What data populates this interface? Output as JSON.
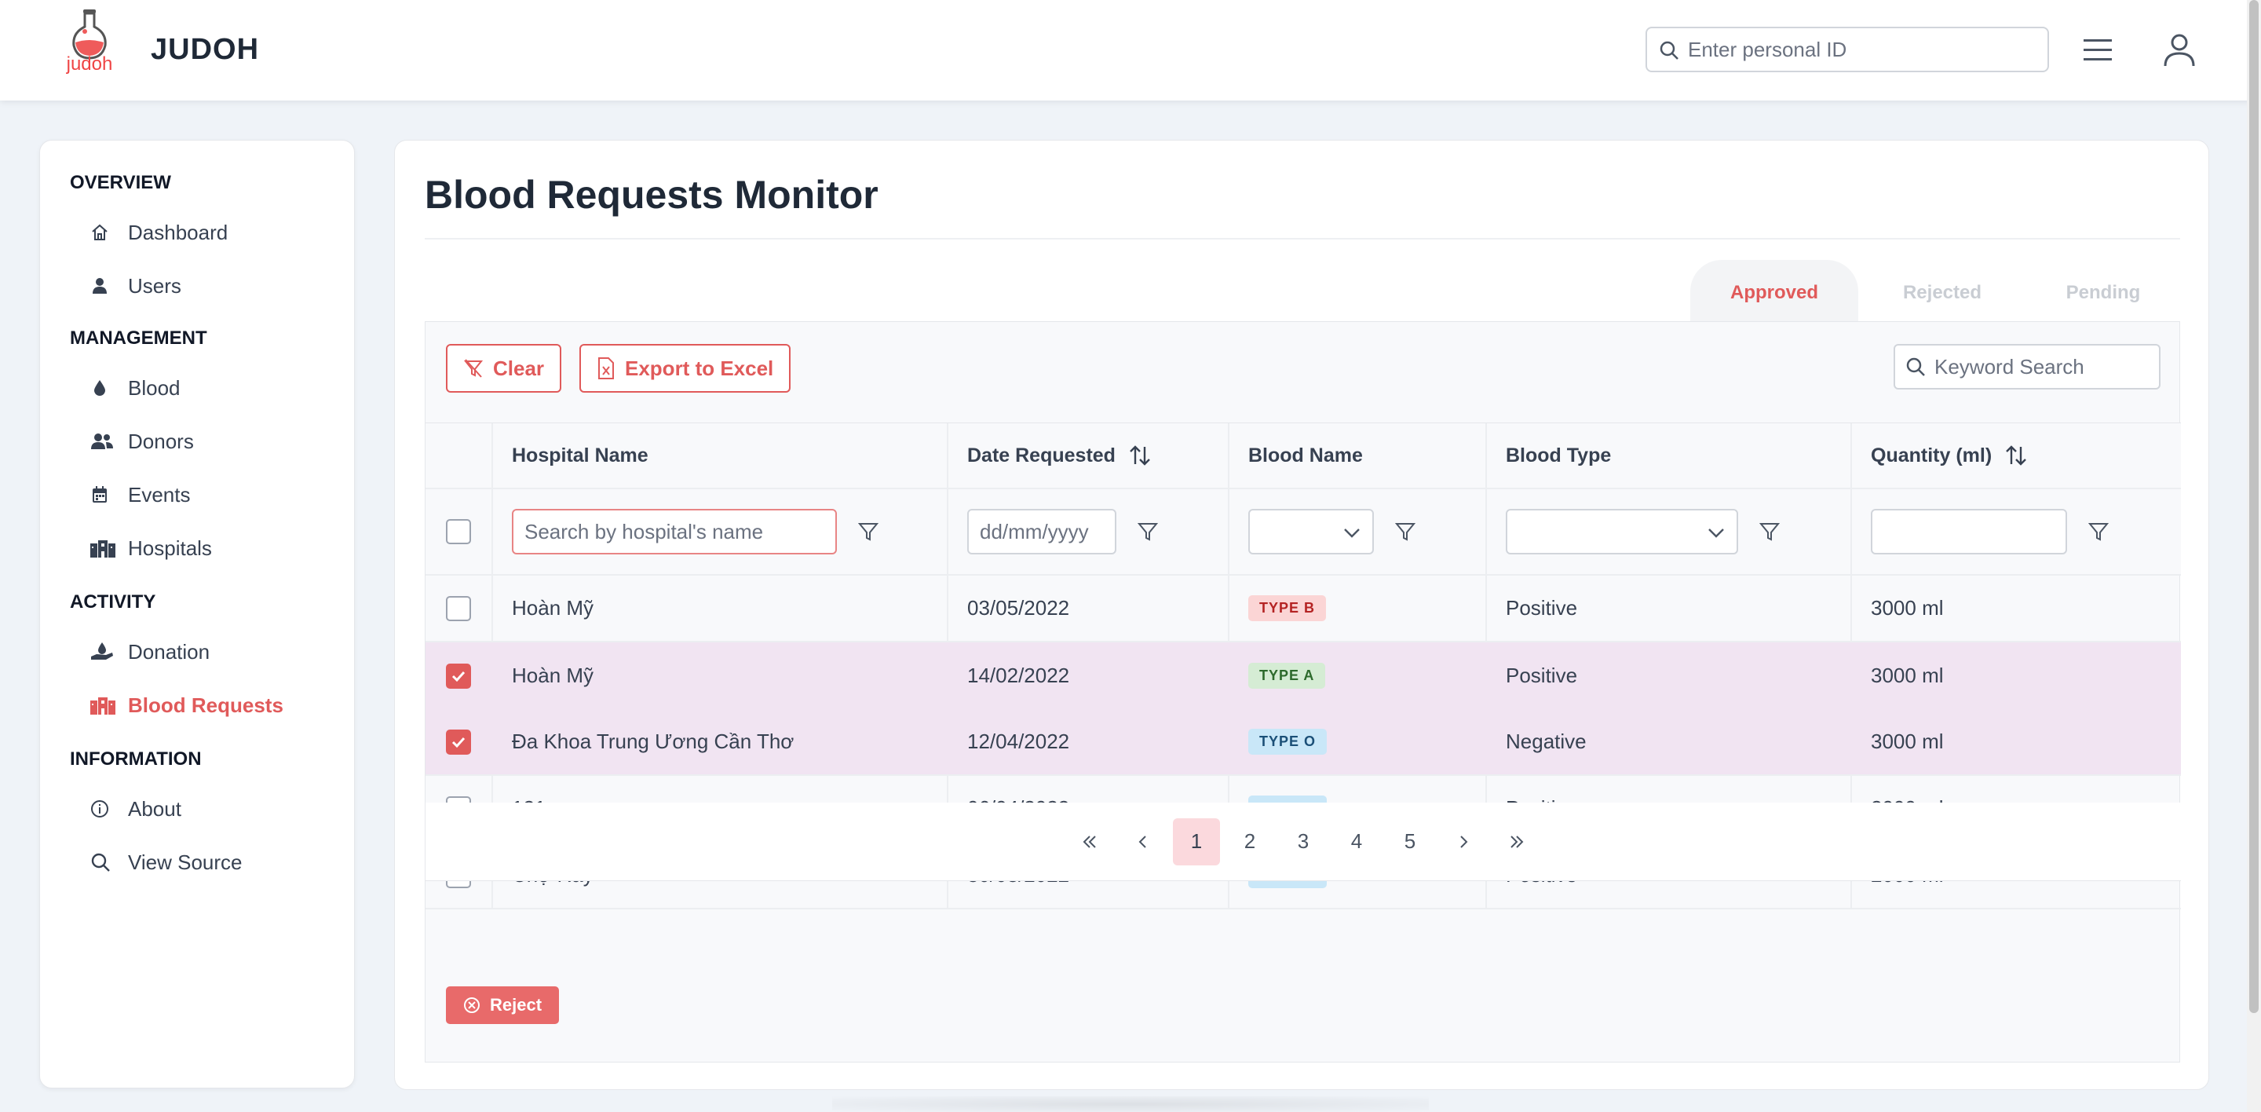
{
  "app": {
    "logo_text": "judoh",
    "brand": "JUDOH"
  },
  "header": {
    "search_placeholder": "Enter personal ID"
  },
  "sidebar": {
    "sections": [
      {
        "title": "OVERVIEW",
        "items": [
          {
            "label": "Dashboard",
            "icon": "home-icon"
          },
          {
            "label": "Users",
            "icon": "user-icon"
          }
        ]
      },
      {
        "title": "MANAGEMENT",
        "items": [
          {
            "label": "Blood",
            "icon": "drop-icon"
          },
          {
            "label": "Donors",
            "icon": "users-icon"
          },
          {
            "label": "Events",
            "icon": "calendar-icon"
          },
          {
            "label": "Hospitals",
            "icon": "building-icon"
          }
        ]
      },
      {
        "title": "ACTIVITY",
        "items": [
          {
            "label": "Donation",
            "icon": "hand-drop-icon"
          },
          {
            "label": "Blood Requests",
            "icon": "building-icon",
            "active": true
          }
        ]
      },
      {
        "title": "INFORMATION",
        "items": [
          {
            "label": "About",
            "icon": "info-icon"
          },
          {
            "label": "View Source",
            "icon": "search-icon"
          }
        ]
      }
    ]
  },
  "main": {
    "title": "Blood Requests Monitor",
    "tabs": [
      {
        "label": "Approved",
        "active": true
      },
      {
        "label": "Rejected"
      },
      {
        "label": "Pending"
      }
    ],
    "toolbar": {
      "clear_label": "Clear",
      "export_label": "Export to Excel",
      "keyword_placeholder": "Keyword Search"
    },
    "table": {
      "columns": [
        "Hospital Name",
        "Date Requested",
        "Blood Name",
        "Blood Type",
        "Quantity (ml)"
      ],
      "filters": {
        "hospital_placeholder": "Search by hospital's name",
        "date_placeholder": "dd/mm/yyyy"
      },
      "rows": [
        {
          "hospital": "Hoàn Mỹ",
          "date": "03/05/2022",
          "blood_name": "TYPE B",
          "badge": "b",
          "blood_type": "Positive",
          "quantity": "3000 ml",
          "selected": false
        },
        {
          "hospital": "Hoàn Mỹ",
          "date": "14/02/2022",
          "blood_name": "TYPE A",
          "badge": "a",
          "blood_type": "Positive",
          "quantity": "3000 ml",
          "selected": true
        },
        {
          "hospital": "Đa Khoa Trung Ương Cần Thơ",
          "date": "12/04/2022",
          "blood_name": "TYPE O",
          "badge": "o",
          "blood_type": "Negative",
          "quantity": "3000 ml",
          "selected": true
        },
        {
          "hospital": "121",
          "date": "06/04/2022",
          "blood_name": "TYPE O",
          "badge": "o",
          "blood_type": "Positive",
          "quantity": "2000 ml",
          "selected": false
        },
        {
          "hospital": "Chợ Rẫy",
          "date": "30/03/2022",
          "blood_name": "TYPE O",
          "badge": "o",
          "blood_type": "Positive",
          "quantity": "2000 ml",
          "selected": false
        }
      ]
    },
    "pagination": {
      "pages": [
        "1",
        "2",
        "3",
        "4",
        "5"
      ],
      "current": "1"
    },
    "reject_label": "Reject"
  },
  "colors": {
    "accent": "#e05a5a",
    "selected_row": "#f1e4f2"
  }
}
